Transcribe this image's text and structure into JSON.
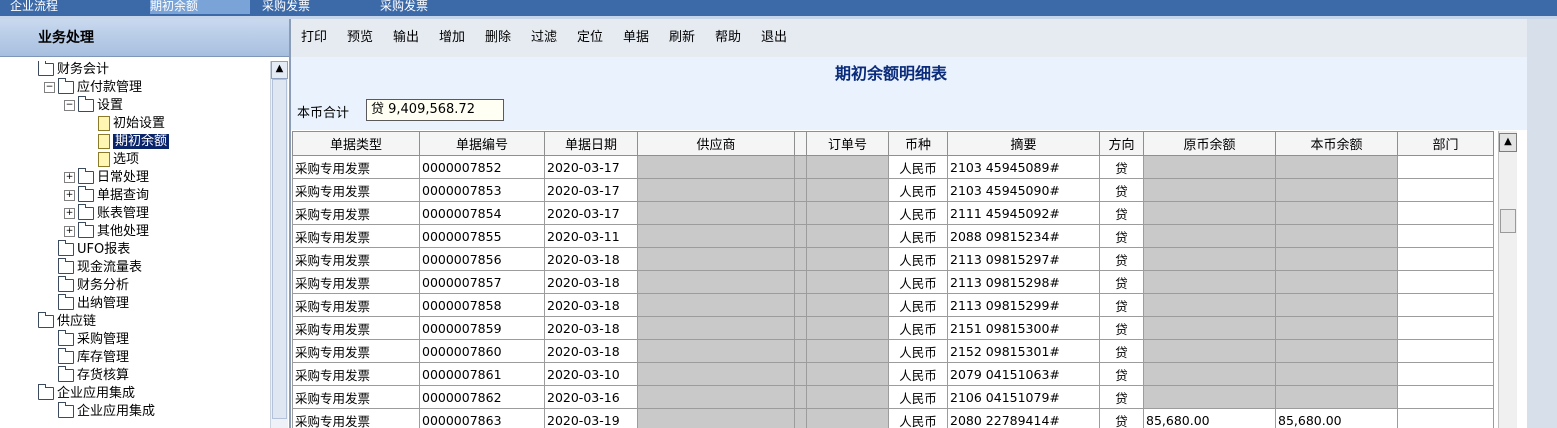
{
  "top_tabs": [
    {
      "label": "企业流程",
      "active": false
    },
    {
      "label": "期初余额",
      "active": true
    },
    {
      "label": "采购发票",
      "active": false
    },
    {
      "label": "采购发票",
      "active": false
    }
  ],
  "left_panel": {
    "title": "业务处理",
    "tree": [
      {
        "label": "财务会计",
        "level": 0,
        "icon": "folder-icon",
        "expander": ""
      },
      {
        "label": "应付款管理",
        "level": 1,
        "icon": "folder-icon",
        "expander": "−"
      },
      {
        "label": "设置",
        "level": 2,
        "icon": "folder-icon",
        "expander": "−"
      },
      {
        "label": "初始设置",
        "level": 3,
        "icon": "document-icon",
        "expander": ""
      },
      {
        "label": "期初余额",
        "level": 3,
        "icon": "document-icon",
        "expander": "",
        "selected": true
      },
      {
        "label": "选项",
        "level": 3,
        "icon": "document-icon",
        "expander": ""
      },
      {
        "label": "日常处理",
        "level": 2,
        "icon": "folder-icon",
        "expander": "+"
      },
      {
        "label": "单据查询",
        "level": 2,
        "icon": "folder-icon",
        "expander": "+"
      },
      {
        "label": "账表管理",
        "level": 2,
        "icon": "folder-icon",
        "expander": "+"
      },
      {
        "label": "其他处理",
        "level": 2,
        "icon": "folder-icon",
        "expander": "+"
      },
      {
        "label": "UFO报表",
        "level": 1,
        "icon": "folder-icon",
        "expander": ""
      },
      {
        "label": "现金流量表",
        "level": 1,
        "icon": "folder-icon",
        "expander": ""
      },
      {
        "label": "财务分析",
        "level": 1,
        "icon": "folder-icon",
        "expander": ""
      },
      {
        "label": "出纳管理",
        "level": 1,
        "icon": "folder-icon",
        "expander": ""
      },
      {
        "label": "供应链",
        "level": 0,
        "icon": "folder-icon",
        "expander": ""
      },
      {
        "label": "采购管理",
        "level": 1,
        "icon": "folder-icon",
        "expander": ""
      },
      {
        "label": "库存管理",
        "level": 1,
        "icon": "folder-icon",
        "expander": ""
      },
      {
        "label": "存货核算",
        "level": 1,
        "icon": "folder-icon",
        "expander": ""
      },
      {
        "label": "企业应用集成",
        "level": 0,
        "icon": "folder-icon",
        "expander": ""
      },
      {
        "label": "企业应用集成",
        "level": 1,
        "icon": "folder-icon",
        "expander": ""
      }
    ]
  },
  "toolbar": [
    "打印",
    "预览",
    "输出",
    "增加",
    "删除",
    "过滤",
    "定位",
    "单据",
    "刷新",
    "帮助",
    "退出"
  ],
  "report": {
    "title": "期初余额明细表",
    "total_label": "本币合计",
    "total_value": "贷 9,409,568.72"
  },
  "columns": [
    "单据类型",
    "单据编号",
    "单据日期",
    "供应商",
    "",
    "订单号",
    "币种",
    "摘要",
    "方向",
    "原币余额",
    "本币余额",
    "部门"
  ],
  "rows": [
    [
      "采购专用发票",
      "0000007852",
      "2020-03-17",
      "",
      "",
      "",
      "人民币",
      "2103 45945089#",
      "贷",
      "",
      "",
      ""
    ],
    [
      "采购专用发票",
      "0000007853",
      "2020-03-17",
      "",
      "",
      "",
      "人民币",
      "2103 45945090#",
      "贷",
      "",
      "",
      ""
    ],
    [
      "采购专用发票",
      "0000007854",
      "2020-03-17",
      "",
      "",
      "",
      "人民币",
      "2111 45945092#",
      "贷",
      "",
      "",
      ""
    ],
    [
      "采购专用发票",
      "0000007855",
      "2020-03-11",
      "",
      "",
      "",
      "人民币",
      "2088 09815234#",
      "贷",
      "",
      "",
      ""
    ],
    [
      "采购专用发票",
      "0000007856",
      "2020-03-18",
      "",
      "",
      "",
      "人民币",
      "2113 09815297#",
      "贷",
      "",
      "",
      ""
    ],
    [
      "采购专用发票",
      "0000007857",
      "2020-03-18",
      "",
      "",
      "",
      "人民币",
      "2113 09815298#",
      "贷",
      "",
      "",
      ""
    ],
    [
      "采购专用发票",
      "0000007858",
      "2020-03-18",
      "",
      "",
      "",
      "人民币",
      "2113 09815299#",
      "贷",
      "",
      "",
      ""
    ],
    [
      "采购专用发票",
      "0000007859",
      "2020-03-18",
      "",
      "",
      "",
      "人民币",
      "2151 09815300#",
      "贷",
      "",
      "",
      ""
    ],
    [
      "采购专用发票",
      "0000007860",
      "2020-03-18",
      "",
      "",
      "",
      "人民币",
      "2152 09815301#",
      "贷",
      "",
      "",
      ""
    ],
    [
      "采购专用发票",
      "0000007861",
      "2020-03-10",
      "",
      "",
      "",
      "人民币",
      "2079 04151063#",
      "贷",
      "",
      "",
      ""
    ],
    [
      "采购专用发票",
      "0000007862",
      "2020-03-16",
      "",
      "",
      "",
      "人民币",
      "2106 04151079#",
      "贷",
      "",
      "",
      ""
    ],
    [
      "采购专用发票",
      "0000007863",
      "2020-03-19",
      "",
      "",
      "",
      "人民币",
      "2080 22789414#",
      "贷",
      "85,680.00",
      "85,680.00",
      ""
    ]
  ],
  "colors": {
    "topbar": "#3c6aa8",
    "report_bg": "#e9f2fd",
    "title_text": "#0a2b7a",
    "selected_node": "#0a246a"
  }
}
